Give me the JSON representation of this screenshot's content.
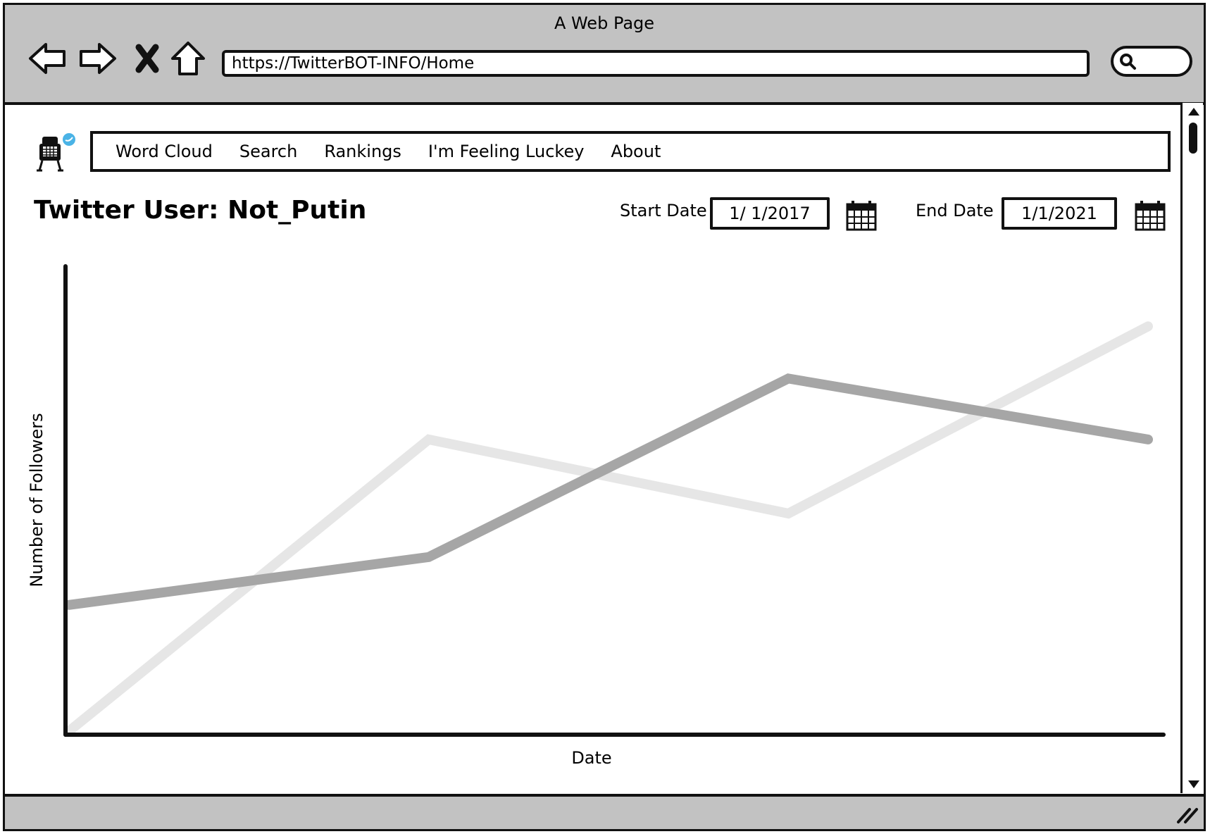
{
  "window": {
    "title": "A Web Page",
    "url": "https://TwitterBOT-INFO/Home"
  },
  "icons": {
    "back": "back-arrow-icon",
    "forward": "forward-arrow-icon",
    "stop": "close-icon",
    "home": "home-icon",
    "search": "search-icon",
    "calendar": "calendar-icon",
    "logo": "twitter-bot-logo"
  },
  "menu": {
    "items": [
      {
        "label": "Word Cloud"
      },
      {
        "label": "Search"
      },
      {
        "label": "Rankings"
      },
      {
        "label": "I'm Feeling Luckey"
      },
      {
        "label": "About"
      }
    ]
  },
  "page": {
    "title": "Twitter User: Not_Putin",
    "start_label": "Start Date",
    "start_value": "1/ 1/2017",
    "end_label": "End Date",
    "end_value": "1/1/2021"
  },
  "chart_data": {
    "type": "line",
    "title": "",
    "xlabel": "Date",
    "ylabel": "Number of Followers",
    "x": [
      0,
      1,
      2,
      3
    ],
    "ylim": [
      0,
      100
    ],
    "grid": false,
    "legend": "none",
    "series": [
      {
        "values": [
          29,
          40,
          81,
          67
        ],
        "color": "#a6a6a6"
      },
      {
        "values": [
          0,
          67,
          50,
          93
        ],
        "color": "#e6e6e6"
      }
    ]
  }
}
